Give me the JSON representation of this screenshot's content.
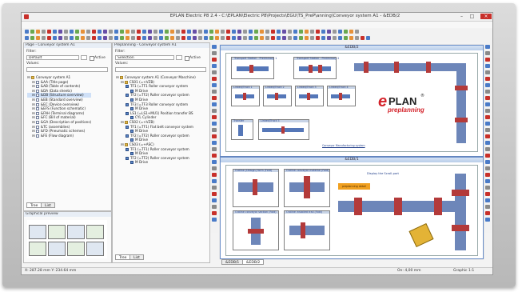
{
  "window": {
    "title": "EPLAN Electric P8 2.4 - C:\\EPLAN\\Electric P8\\Projects\\EGU\\TS_PreP\\anning\\Conveyor system A1 - &EDB/2",
    "minimize": "–",
    "maximize": "□",
    "close": "×"
  },
  "menubar": [
    "Project",
    "Page",
    "Layout space",
    "Edit",
    "View",
    "Insert",
    "Project data",
    "Find",
    "Options",
    "Utilities",
    "Window",
    "Help"
  ],
  "page_nav": {
    "title": "Page - Conveyor system A1",
    "filter_label": "Filter:",
    "filter_value": "Default",
    "active_label": "Active",
    "values_label": "Values:",
    "tree": [
      {
        "label": "Conveyor system A1",
        "level": 0,
        "icon": "project-icon"
      },
      {
        "label": "&AA (Title page)",
        "level": 1,
        "icon": "page-icon"
      },
      {
        "label": "&AB (Table of contents)",
        "level": 1,
        "icon": "page-icon"
      },
      {
        "label": "&DA (Data sheets)",
        "level": 1,
        "icon": "page-icon"
      },
      {
        "label": "&DB (Structure overview)",
        "level": 1,
        "icon": "page-icon",
        "selected": true
      },
      {
        "label": "&EB (Standard overview)",
        "level": 1,
        "icon": "page-icon"
      },
      {
        "label": "&EC (Device overview)",
        "level": 1,
        "icon": "page-icon"
      },
      {
        "label": "&EFS (Function schematic)",
        "level": 1,
        "icon": "page-icon"
      },
      {
        "label": "&FAH (Terminal diagrams)",
        "level": 1,
        "icon": "page-icon"
      },
      {
        "label": "&FC (Bill of material)",
        "level": 1,
        "icon": "page-icon"
      },
      {
        "label": "&GA (Description of positions)",
        "level": 1,
        "icon": "page-icon"
      },
      {
        "label": "&TC (assemblies)",
        "level": 1,
        "icon": "page-icon"
      },
      {
        "label": "&FD (Pneumatic schemes)",
        "level": 1,
        "icon": "page-icon"
      },
      {
        "label": "&FE (Flow diagram)",
        "level": 1,
        "icon": "page-icon"
      }
    ],
    "tabs": [
      "Tree",
      "List"
    ]
  },
  "graphical_preview": {
    "title": "Graphical preview"
  },
  "prep_nav": {
    "title": "Preplanning - Conveyor system A1",
    "filter_label": "Filter:",
    "filter_value": "Selection",
    "active_label": "Active",
    "values_label": "Values:",
    "tree": [
      {
        "label": "Conveyor system A1 (Conveyor Maschine)",
        "level": 0,
        "icon": "project-icon"
      },
      {
        "label": "CS01 (=+VZB)",
        "level": 1,
        "icon": "folder-icon"
      },
      {
        "label": "TF1 (=TF1 Roller conveyor system",
        "level": 2,
        "icon": "device-icon"
      },
      {
        "label": "M Drive",
        "level": 3,
        "icon": "device-icon"
      },
      {
        "label": "TF2 (=TF2) Roller conveyor system",
        "level": 2,
        "icon": "device-icon"
      },
      {
        "label": "M Drive",
        "level": 3,
        "icon": "device-icon"
      },
      {
        "label": "TF3 (=TF3 Roller conveyor system",
        "level": 2,
        "icon": "device-icon"
      },
      {
        "label": "M Drive",
        "level": 3,
        "icon": "device-icon"
      },
      {
        "label": "LS1 (=LS1+MU1) Position transfer BS",
        "level": 2,
        "icon": "device-icon"
      },
      {
        "label": "CYL Cylinder",
        "level": 3,
        "icon": "device-icon"
      },
      {
        "label": "CS02 (=+VZB)",
        "level": 1,
        "icon": "folder-icon"
      },
      {
        "label": "TF1 (=TF1) Flat belt conveyor system",
        "level": 2,
        "icon": "device-icon"
      },
      {
        "label": "M Drive",
        "level": 3,
        "icon": "device-icon"
      },
      {
        "label": "TF2 (=TF2) Roller conveyor system",
        "level": 2,
        "icon": "device-icon"
      },
      {
        "label": "M Drive",
        "level": 3,
        "icon": "device-icon"
      },
      {
        "label": "CS03 (=+ASC)",
        "level": 1,
        "icon": "folder-icon"
      },
      {
        "label": "TF1 (=TF1) Roller conveyor system",
        "level": 2,
        "icon": "device-icon"
      },
      {
        "label": "M Drive",
        "level": 3,
        "icon": "device-icon"
      },
      {
        "label": "TF2 (=TF2) Roller conveyor system",
        "level": 2,
        "icon": "device-icon"
      },
      {
        "label": "M Drive",
        "level": 3,
        "icon": "device-icon"
      }
    ],
    "tabs": [
      "Tree",
      "List"
    ]
  },
  "top_window": {
    "title": "&EDB/2",
    "boxes": [
      "Transport Station - Preliminary 1",
      "Transport Station - Preliminary 2",
      "Linked/Track 1",
      "Linked/Track 2",
      "Linked/Track 3",
      "Linked/Track 4",
      "Transfer",
      "Linked/Track 5"
    ],
    "footnote": "Conveyor Manufacturing system",
    "logo_text": "PLAN",
    "logo_e": "e",
    "logo_reg": "®",
    "logo_sub": "preplanning"
  },
  "bottom_window": {
    "title": "&EDB/1",
    "boxes": [
      "Outline (Design) form (Fold)",
      "Outline conveyor material (Fold)",
      "Outline conveyor section (Fold)",
      "Outline installed trail (Fold)"
    ],
    "note": "Display the Scroll-part",
    "tag": "preplanning detail"
  },
  "doc_tabs": [
    "&EDB/1",
    "&EDB/2"
  ],
  "statusbar": {
    "coords": "X: 287.28 mm  Y: 234.64 mm",
    "grid": "On: 4,00 mm",
    "mode": "Graphic 1:1"
  },
  "colors": {
    "accent_red": "#c8302a",
    "conveyor_blue": "#5577b8",
    "device_red": "#b33a3a",
    "panel_orange": "#f0a020"
  }
}
